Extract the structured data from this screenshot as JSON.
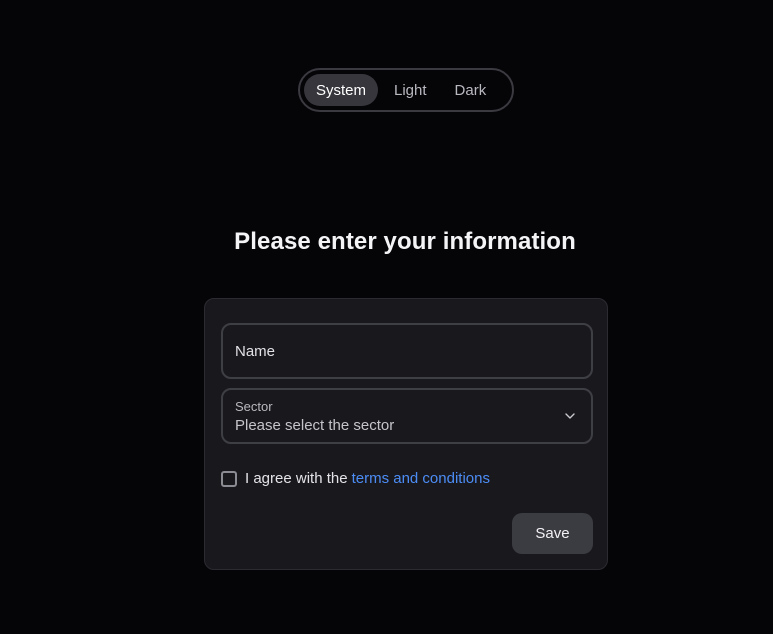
{
  "theme_switch": {
    "options": [
      {
        "label": "System",
        "active": true
      },
      {
        "label": "Light",
        "active": false
      },
      {
        "label": "Dark",
        "active": false
      }
    ]
  },
  "heading": "Please enter your information",
  "form": {
    "name_field": {
      "label": "Name",
      "value": ""
    },
    "sector_field": {
      "label": "Sector",
      "placeholder": "Please select the sector",
      "icon": "chevron-down-icon"
    },
    "agree": {
      "text": "I agree with the",
      "link_text": "terms and conditions",
      "checked": false
    },
    "save_label": "Save"
  },
  "colors": {
    "background": "#050508",
    "card": "#19191d",
    "link": "#4c8cf5",
    "button": "#3b3b42"
  }
}
